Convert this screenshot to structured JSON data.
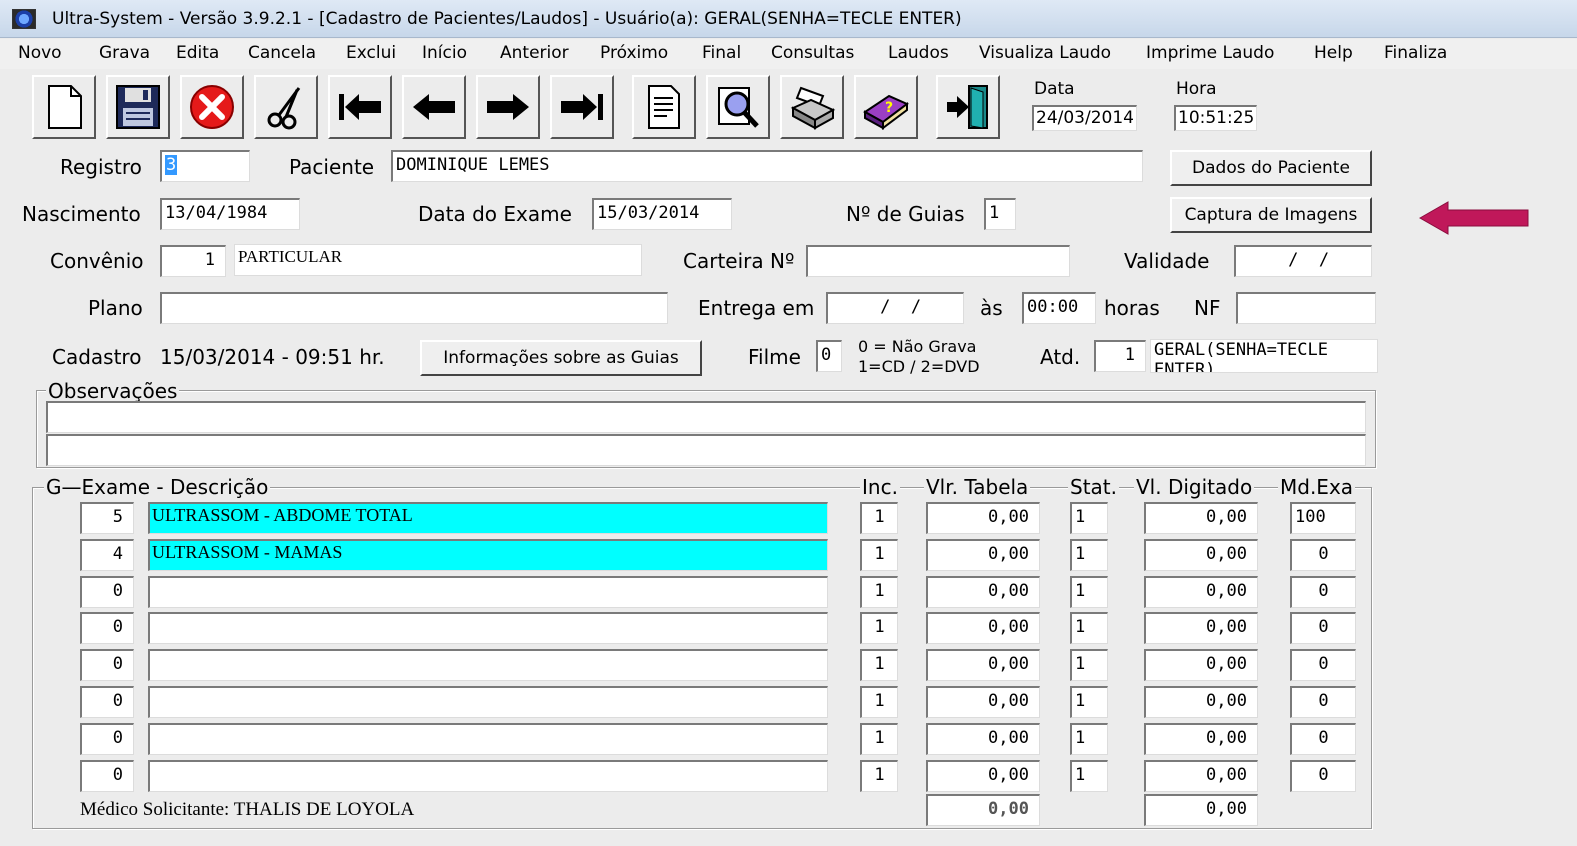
{
  "window": {
    "title": "Ultra-System - Versão 3.9.2.1 - [Cadastro de Pacientes/Laudos] - Usuário(a): GERAL(SENHA=TECLE ENTER)"
  },
  "menu": [
    "Novo",
    "Grava",
    "Edita",
    "Cancela",
    "Exclui",
    "Início",
    "Anterior",
    "Próximo",
    "Final",
    "Consultas",
    "Laudos",
    "Visualiza Laudo",
    "Imprime Laudo",
    "Help",
    "Finaliza"
  ],
  "toolbar": {
    "buttons": [
      "new-document-icon",
      "save-icon",
      "cancel-icon",
      "scissors-icon",
      "first-record-icon",
      "previous-record-icon",
      "next-record-icon",
      "last-record-icon",
      "report-icon",
      "search-icon",
      "print-icon",
      "help-book-icon",
      "exit-icon"
    ],
    "date_label": "Data",
    "date_value": "24/03/2014",
    "time_label": "Hora",
    "time_value": "10:51:25"
  },
  "form": {
    "registro_label": "Registro",
    "registro_value": "3",
    "paciente_label": "Paciente",
    "paciente_value": "DOMINIQUE LEMES",
    "dados_paciente_button": "Dados do Paciente",
    "nascimento_label": "Nascimento",
    "nascimento_value": "13/04/1984",
    "data_exame_label": "Data do Exame",
    "data_exame_value": "15/03/2014",
    "guias_label": "Nº de Guias",
    "guias_value": "1",
    "captura_button": "Captura de Imagens",
    "convenio_label": "Convênio",
    "convenio_code": "1",
    "convenio_name": "PARTICULAR",
    "carteira_label": "Carteira Nº",
    "carteira_value": "",
    "validade_label": "Validade",
    "validade_value": " /  /",
    "plano_label": "Plano",
    "plano_value": "",
    "entrega_label": "Entrega em",
    "entrega_value": " /  /",
    "as_label": "às",
    "hora_value": "00:00",
    "horas_label": "horas",
    "nf_label": "NF",
    "nf_value": "",
    "cadastro_label": "Cadastro",
    "cadastro_value": "15/03/2014 - 09:51 hr.",
    "info_guias_button": "Informações sobre as Guias",
    "filme_label": "Filme",
    "filme_value": "0",
    "filme_hint_1": "0 = Não Grava",
    "filme_hint_2": "1=CD  /  2=DVD",
    "atd_label": "Atd.",
    "atd_code": "1",
    "atd_name": "GERAL(SENHA=TECLE ENTER)"
  },
  "observacoes": {
    "title": "Observações",
    "line1": "",
    "line2": ""
  },
  "exams": {
    "headers": {
      "left": "G—Exame - Descrição",
      "inc": "Inc.",
      "vlr_tabela": "Vlr. Tabela",
      "stat": "Stat.",
      "vl_digitado": "Vl. Digitado",
      "md_exa": "Md.Exa"
    },
    "rows": [
      {
        "code": "5",
        "desc": "ULTRASSOM - ABDOME TOTAL",
        "inc": "1",
        "vlr": "0,00",
        "stat": "1",
        "vld": "0,00",
        "md": "100"
      },
      {
        "code": "4",
        "desc": "ULTRASSOM - MAMAS",
        "inc": "1",
        "vlr": "0,00",
        "stat": "1",
        "vld": "0,00",
        "md": "0"
      },
      {
        "code": "0",
        "desc": "",
        "inc": "1",
        "vlr": "0,00",
        "stat": "1",
        "vld": "0,00",
        "md": "0"
      },
      {
        "code": "0",
        "desc": "",
        "inc": "1",
        "vlr": "0,00",
        "stat": "1",
        "vld": "0,00",
        "md": "0"
      },
      {
        "code": "0",
        "desc": "",
        "inc": "1",
        "vlr": "0,00",
        "stat": "1",
        "vld": "0,00",
        "md": "0"
      },
      {
        "code": "0",
        "desc": "",
        "inc": "1",
        "vlr": "0,00",
        "stat": "1",
        "vld": "0,00",
        "md": "0"
      },
      {
        "code": "0",
        "desc": "",
        "inc": "1",
        "vlr": "0,00",
        "stat": "1",
        "vld": "0,00",
        "md": "0"
      },
      {
        "code": "0",
        "desc": "",
        "inc": "1",
        "vlr": "0,00",
        "stat": "1",
        "vld": "0,00",
        "md": "0"
      }
    ],
    "medico_label": "Médico Solicitante: THALIS DE LOYOLA",
    "total_tabela": "0,00",
    "total_digitado": "0,00"
  },
  "colors": {
    "highlight": "#00ffff",
    "arrow": "#c0185a"
  }
}
